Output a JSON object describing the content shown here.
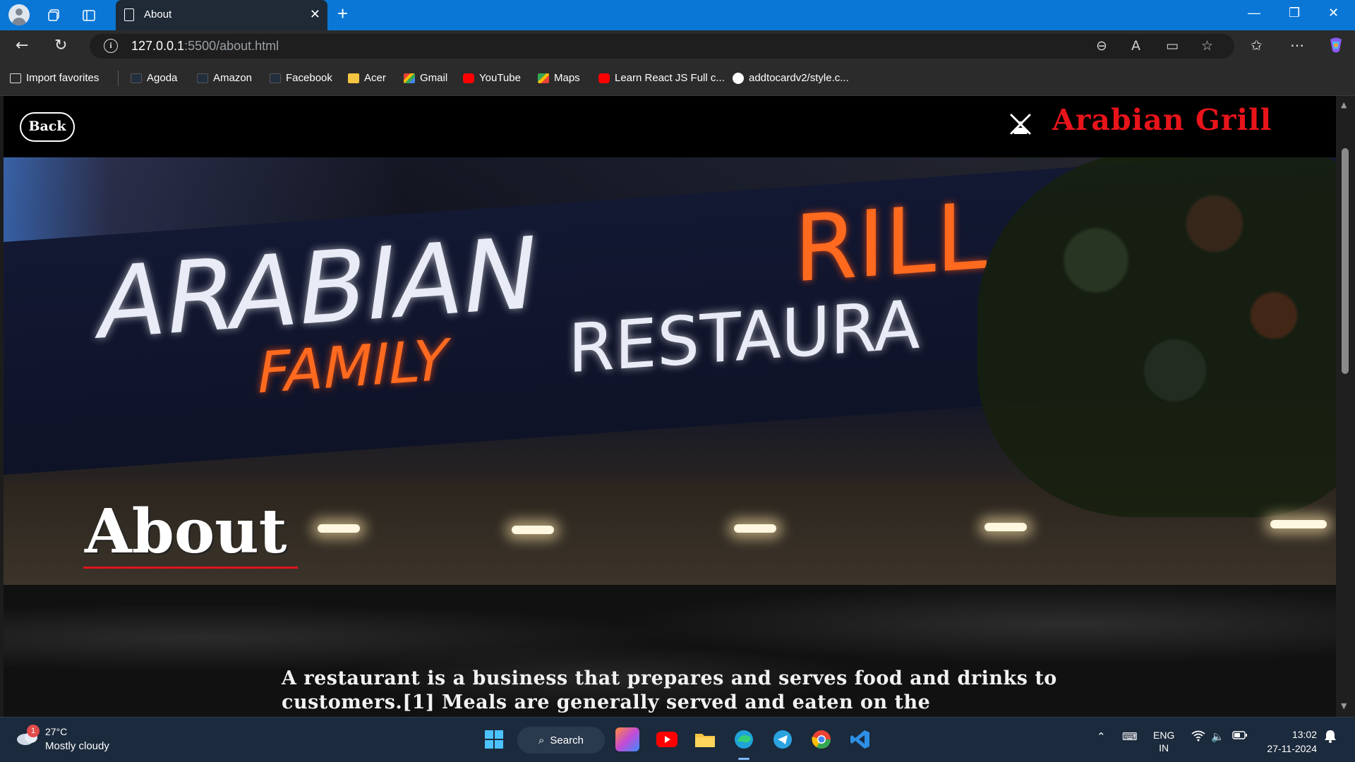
{
  "browser": {
    "tab_title": "About",
    "url_host": "127.0.0.1",
    "url_rest": ":5500/about.html",
    "bookmarks": [
      {
        "label": "Import favorites",
        "icon": "import-icon"
      },
      {
        "label": "Agoda",
        "icon": "aws-icon"
      },
      {
        "label": "Amazon",
        "icon": "aws-icon"
      },
      {
        "label": "Facebook",
        "icon": "aws-icon"
      },
      {
        "label": "Acer",
        "icon": "folder-icon"
      },
      {
        "label": "Gmail",
        "icon": "gmail-icon"
      },
      {
        "label": "YouTube",
        "icon": "youtube-icon"
      },
      {
        "label": "Maps",
        "icon": "maps-icon"
      },
      {
        "label": "Learn React JS Full c...",
        "icon": "youtube-icon"
      },
      {
        "label": "addtocardv2/style.c...",
        "icon": "github-icon"
      }
    ]
  },
  "page": {
    "back_label": "Back",
    "brand": "Arabian Grill",
    "hero_sign_top": "ARABIAN",
    "hero_sign_grill": "RILL",
    "hero_sign_family": "FAMILY",
    "hero_sign_restaurant": "RESTAURA",
    "heading": "About",
    "body_text": "A restaurant is a business that prepares and serves food and drinks to customers.[1] Meals are generally served and eaten on the"
  },
  "taskbar": {
    "weather_badge": "1",
    "temperature": "27°C",
    "condition": "Mostly cloudy",
    "search_label": "Search",
    "lang_top": "ENG",
    "lang_bottom": "IN",
    "time": "13:02",
    "date": "27-11-2024"
  },
  "colors": {
    "titlebar": "#0a77d6",
    "brand_red": "#e8141a",
    "underline_red": "#e0151b"
  }
}
